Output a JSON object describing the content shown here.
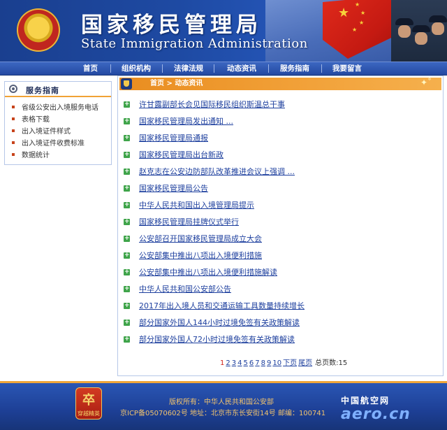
{
  "header": {
    "title_cn": "国家移民管理局",
    "title_en": "State Immigration Administration"
  },
  "nav": {
    "items": [
      "首页",
      "组织机构",
      "法律法规",
      "动态资讯",
      "服务指南",
      "我要留言"
    ]
  },
  "sidebar": {
    "title": "服务指南",
    "items": [
      "省级公安出入境服务电话",
      "表格下载",
      "出入境证件样式",
      "出入境证件收费标准",
      "数据统计"
    ]
  },
  "breadcrumb": {
    "path": "首页 > 动态资讯"
  },
  "news": [
    "许甘露副部长会见国际移民组织斯温总干事",
    "国家移民管理局发出通知 ...",
    "国家移民管理局通报",
    "国家移民管理局出台新政",
    "赵克志在公安边防部队改革推进会议上强调 ...",
    "国家移民管理局公告",
    "中华人民共和国出入境管理局提示",
    "国家移民管理局挂牌仪式举行",
    "公安部召开国家移民管理局成立大会",
    "公安部集中推出八项出入境便利措施",
    "公安部集中推出八项出入境便利措施解读",
    "中华人民共和国公安部公告",
    "2017年出入境人员和交通运输工具数量持续增长",
    "部分国家外国人144小时过境免签有关政策解读",
    "部分国家外国人72小时过境免签有关政策解读"
  ],
  "pager": {
    "current": "1",
    "pages": [
      "2",
      "3",
      "4",
      "5",
      "6",
      "7",
      "8",
      "9",
      "10"
    ],
    "next": "下页",
    "last": "尾页",
    "total": "总页数:15"
  },
  "footer": {
    "logo_glyph": "卒",
    "logo_caption": "穿越精英",
    "copyright": "版权所有：中华人民共和国公安部",
    "icp_address": "京ICP备05070602号 地址：北京市东长安街14号 邮编：100741",
    "brand_cn": "中国航空网",
    "brand_en": "aero.cn"
  }
}
